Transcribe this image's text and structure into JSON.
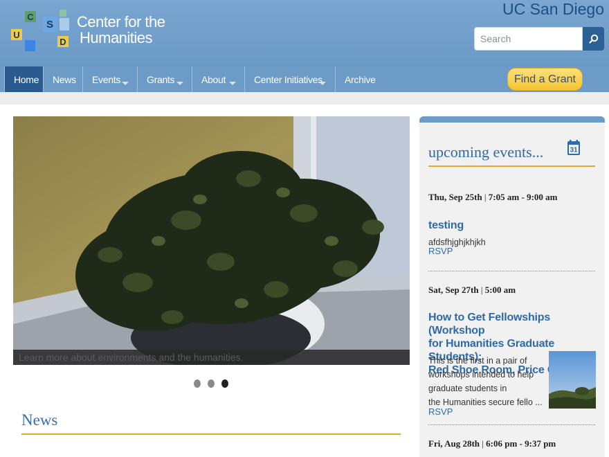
{
  "header": {
    "site_title_line1": "Center for the",
    "site_title_line2": "Humanities",
    "logo_letters": {
      "c": "C",
      "s": "S",
      "u": "U",
      "d": "D"
    },
    "university": "UC San Diego",
    "search": {
      "placeholder": "Search"
    }
  },
  "nav": {
    "items": [
      {
        "label": "Home",
        "active": true
      },
      {
        "label": "News"
      },
      {
        "label": "Events",
        "dropdown": true
      },
      {
        "label": "Grants",
        "dropdown": true
      },
      {
        "label": "About",
        "dropdown": true
      },
      {
        "label": "Center Initiatives",
        "dropdown": true
      },
      {
        "label": "Archive"
      }
    ],
    "cta": "Find a Grant"
  },
  "slideshow": {
    "caption": "Learn more about environments and the humanities.",
    "slide_count": 3,
    "current_slide": 3
  },
  "news": {
    "heading": "News"
  },
  "events": {
    "heading": "upcoming events...",
    "calendar_day": "31",
    "items": [
      {
        "date": "Thu, Sep 25th",
        "time": "7:05 am - 9:00 am",
        "title": "testing",
        "description": "afdsfhjghjkhjkh",
        "rsvp": "RSVP"
      },
      {
        "date": "Sat, Sep 27th",
        "time": "5:00 am",
        "title_lines": [
          "How to Get Fellowships (Workshop",
          "for Humanities Graduate Students);",
          "Red Shoe Room, Price Center"
        ],
        "description_lines": [
          "This is the first in a pair of",
          "workshops intended to help",
          "graduate students in",
          "the Humanities secure fello ..."
        ],
        "rsvp": "RSVP"
      },
      {
        "date": "Fri, Aug 28th",
        "time": "6:06 pm - 9:37 pm"
      }
    ]
  },
  "colors": {
    "header_blue": "#6d9bc8",
    "nav_active": "#2a5b8e",
    "accent_gold": "#e0a830",
    "link_blue": "#2f6aa6"
  }
}
